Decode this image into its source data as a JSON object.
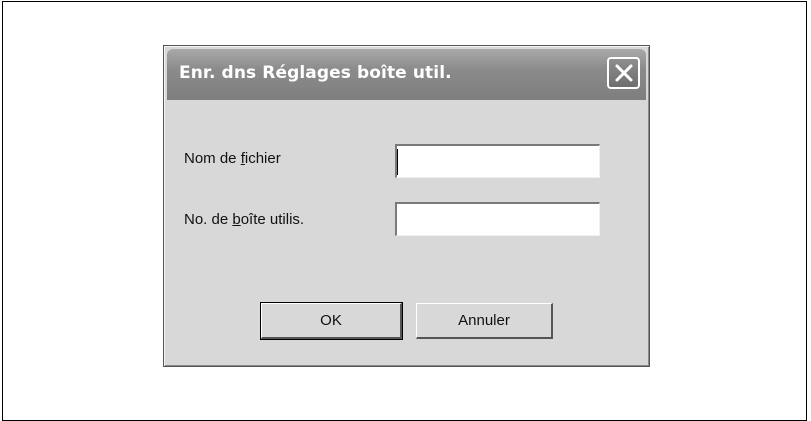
{
  "dialog": {
    "title": "Enr. dns Réglages boîte util.",
    "close_icon": "close-x-icon"
  },
  "fields": {
    "filename": {
      "label_before": "Nom de ",
      "label_mnemonic": "f",
      "label_after": "ichier",
      "value": ""
    },
    "box_number": {
      "label_before": "No. de ",
      "label_mnemonic": "b",
      "label_after": "oîte utilis.",
      "value": ""
    }
  },
  "buttons": {
    "ok_label": "OK",
    "cancel_label": "Annuler"
  }
}
